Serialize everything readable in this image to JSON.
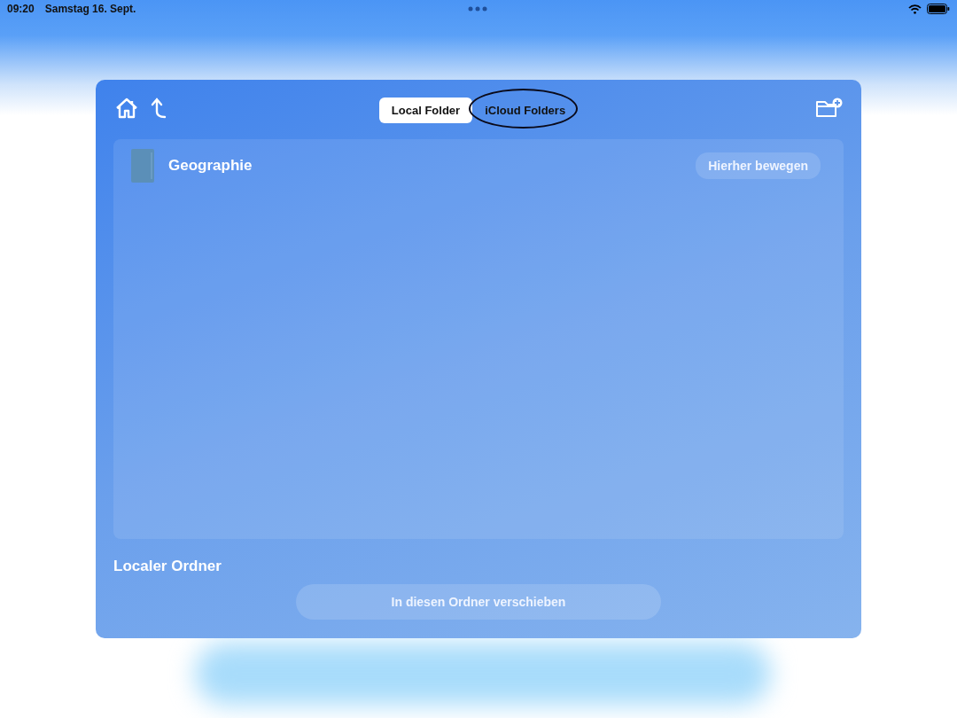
{
  "status_bar": {
    "time": "09:20",
    "date": "Samstag 16. Sept."
  },
  "tabs": [
    {
      "label": "Local Folder",
      "selected": true,
      "circled": false
    },
    {
      "label": "iCloud Folders",
      "selected": false,
      "circled": true
    }
  ],
  "folders": [
    {
      "name": "Geographie",
      "action": "Hierher bewegen"
    }
  ],
  "location": "Localer Ordner",
  "move_button": "In diesen Ordner verschieben"
}
